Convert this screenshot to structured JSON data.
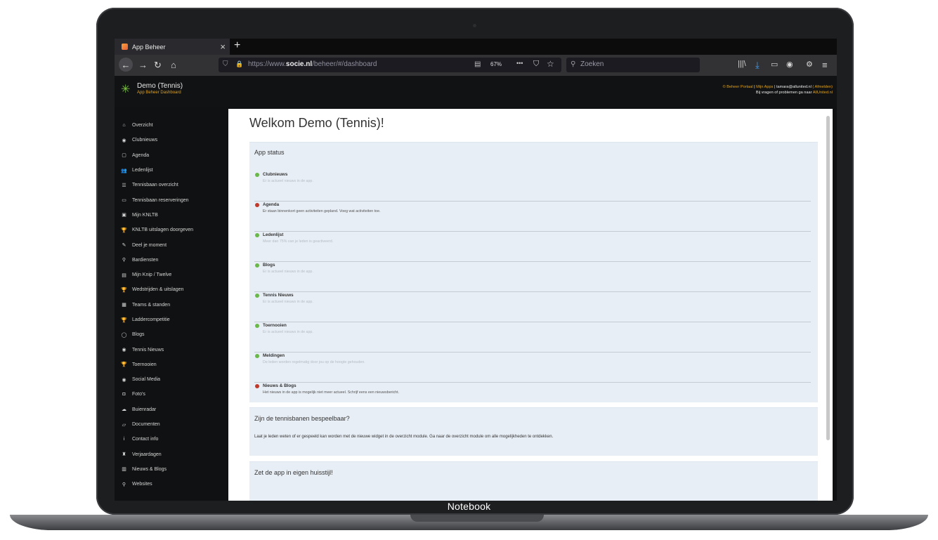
{
  "laptop": {
    "label": "Notebook"
  },
  "browser": {
    "tab_title": "App Beheer",
    "tab_close": "×",
    "new_tab": "+",
    "url_prefix": "https://www.",
    "url_domain": "socie.nl",
    "url_path": "/beheer/#/dashboard",
    "zoom": "67%",
    "more": "•••",
    "search_placeholder": "Zoeken"
  },
  "header": {
    "app_name": "Demo (Tennis)",
    "app_subtitle": "App Beheer Dashboard",
    "portal_link": "© Beheer Portaal",
    "sep1": " | ",
    "my_apps": "Mijn Apps",
    "sep2": " | ",
    "email": "tamara@allunited.nl",
    "logout": " ( Afmelden)",
    "help_text": "Bij vragen of problemen ga naar ",
    "help_link": "AllUnited.nl"
  },
  "sidebar": {
    "items": [
      {
        "label": "Overzicht",
        "icon": "home-icon",
        "glyph": "⌂"
      },
      {
        "label": "Clubnieuws",
        "icon": "globe-icon",
        "glyph": "◉"
      },
      {
        "label": "Agenda",
        "icon": "calendar-icon",
        "glyph": "▢"
      },
      {
        "label": "Ledenlijst",
        "icon": "users-icon",
        "glyph": "👥"
      },
      {
        "label": "Tennisbaan overzicht",
        "icon": "list-icon",
        "glyph": "☰"
      },
      {
        "label": "Tennisbaan reserveringen",
        "icon": "monitor-icon",
        "glyph": "▭"
      },
      {
        "label": "Mijn KNLTB",
        "icon": "id-card-icon",
        "glyph": "▣"
      },
      {
        "label": "KNLTB uitslagen doorgeven",
        "icon": "trophy-icon",
        "glyph": "🏆"
      },
      {
        "label": "Deel je moment",
        "icon": "edit-icon",
        "glyph": "✎"
      },
      {
        "label": "Bardiensten",
        "icon": "link-icon",
        "glyph": "⚲"
      },
      {
        "label": "Mijn Knip / Twelve",
        "icon": "card-icon",
        "glyph": "▤"
      },
      {
        "label": "Wedstrijden & uitslagen",
        "icon": "trophy-icon",
        "glyph": "🏆"
      },
      {
        "label": "Teams & standen",
        "icon": "table-icon",
        "glyph": "▦"
      },
      {
        "label": "Laddercompetitie",
        "icon": "trophy-icon",
        "glyph": "🏆"
      },
      {
        "label": "Blogs",
        "icon": "comment-icon",
        "glyph": "◯"
      },
      {
        "label": "Tennis Nieuws",
        "icon": "globe-icon",
        "glyph": "◉"
      },
      {
        "label": "Toernooien",
        "icon": "trophy-icon",
        "glyph": "🏆"
      },
      {
        "label": "Social Media",
        "icon": "globe-icon",
        "glyph": "◉"
      },
      {
        "label": "Foto's",
        "icon": "camera-icon",
        "glyph": "◘"
      },
      {
        "label": "Buienradar",
        "icon": "cloud-icon",
        "glyph": "☁"
      },
      {
        "label": "Documenten",
        "icon": "folder-icon",
        "glyph": "▱"
      },
      {
        "label": "Contact info",
        "icon": "info-icon",
        "glyph": "i"
      },
      {
        "label": "Verjaardagen",
        "icon": "cake-icon",
        "glyph": "♜"
      },
      {
        "label": "Nieuws & Blogs",
        "icon": "newspaper-icon",
        "glyph": "▥"
      },
      {
        "label": "Websites",
        "icon": "link-icon",
        "glyph": "⚲"
      }
    ]
  },
  "main": {
    "title": "Welkom Demo (Tennis)!",
    "app_status": {
      "title": "App status",
      "items": [
        {
          "name": "Clubnieuws",
          "desc": "Er is actueel nieuws in de app.",
          "status": "ok"
        },
        {
          "name": "Agenda",
          "desc": "Er staan binnenkort geen activiteiten gepland. Voeg wat activiteiten toe.",
          "status": "warn"
        },
        {
          "name": "Ledenlijst",
          "desc": "Meer dan 75% van je leden is geactiveerd.",
          "status": "ok"
        },
        {
          "name": "Blogs",
          "desc": "Er is actueel nieuws in de app.",
          "status": "ok"
        },
        {
          "name": "Tennis Nieuws",
          "desc": "Er is actueel nieuws in de app.",
          "status": "ok"
        },
        {
          "name": "Toernooien",
          "desc": "Er is actueel nieuws in de app.",
          "status": "ok"
        },
        {
          "name": "Meldingen",
          "desc": "De leden worden regelmatig door jou op de hoogte gehouden.",
          "status": "ok"
        },
        {
          "name": "Nieuws & Blogs",
          "desc": "Het nieuws in de app is mogelijk niet meer actueel. Schrijf eens een nieuwsbericht.",
          "status": "warn"
        }
      ]
    },
    "courts_panel": {
      "title": "Zijn de tennisbanen bespeelbaar?",
      "text": "Laat je leden weten of er gespeeld kan worden met de nieuwe widget in de overzicht module. Ga naar de overzicht module om alle mogelijkheden te ontdekken."
    },
    "style_panel": {
      "title": "Zet de app in eigen huisstijl!"
    }
  },
  "colors": {
    "ok": "#6bb84a",
    "warn": "#c0392b",
    "accent": "#e3a21a",
    "download": "#3aa0ff"
  }
}
